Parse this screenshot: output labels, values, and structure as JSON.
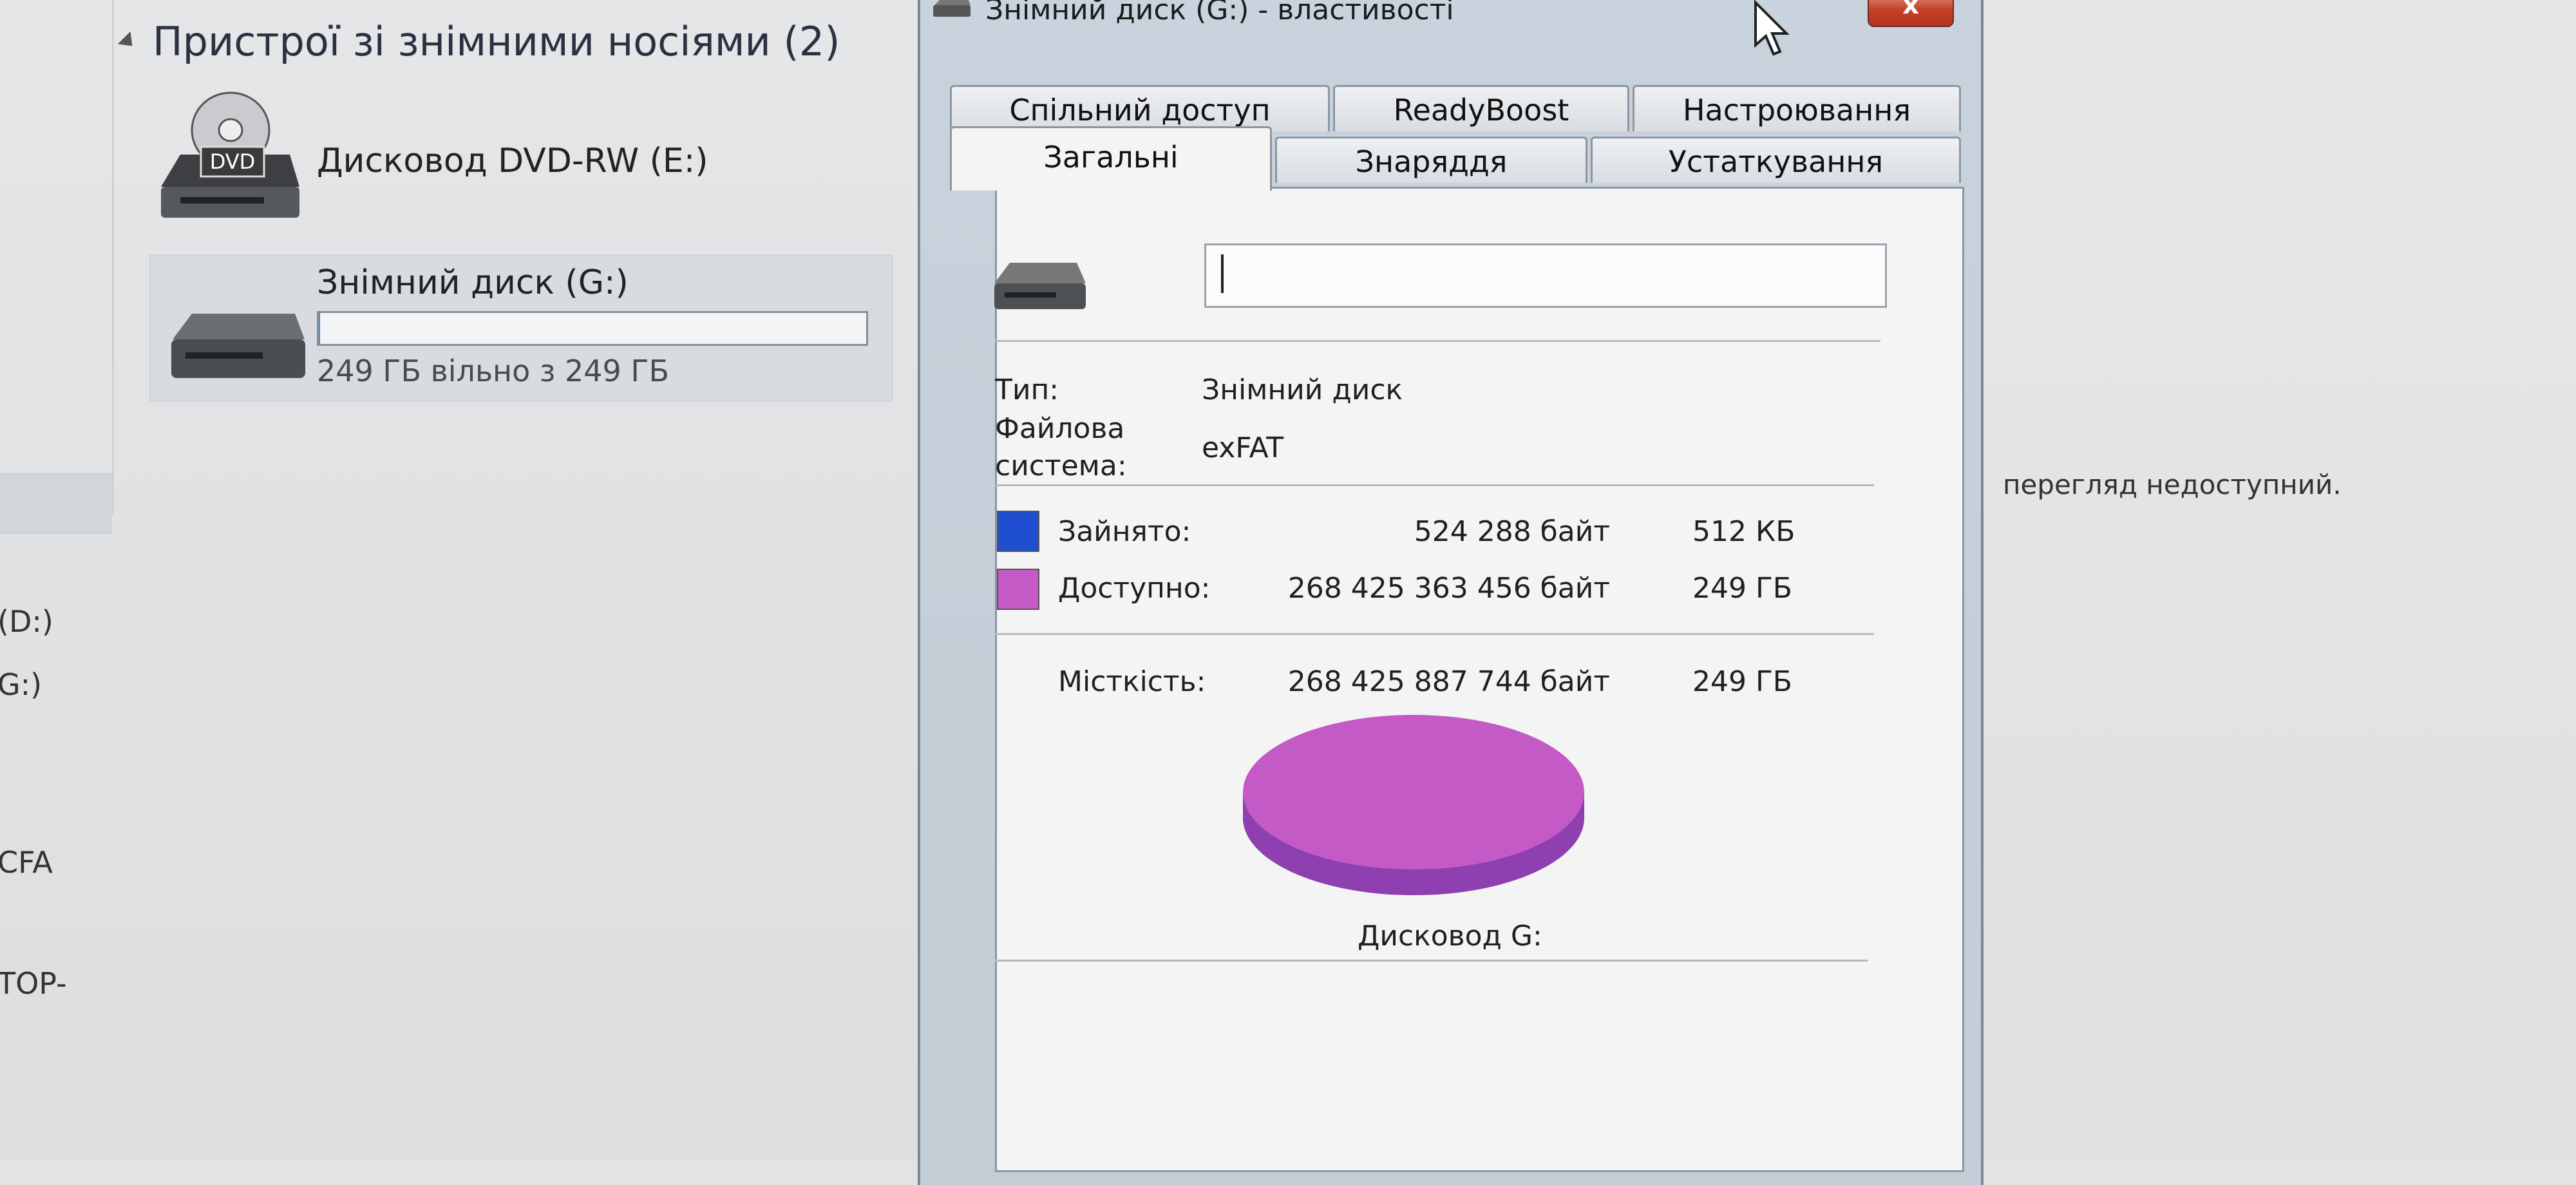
{
  "explorer": {
    "group_header": "Пристрої зі знімними носіями (2)",
    "devices": [
      {
        "name": "Дисковод DVD-RW (E:)",
        "icon": "dvd-drive-icon",
        "icon_label": "DVD"
      },
      {
        "name": "Знімний диск (G:)",
        "icon": "removable-drive-icon",
        "space_text": "249 ГБ вільно з 249 ГБ",
        "used_fraction": 0.002
      }
    ],
    "nav_fragments": [
      "(D:)",
      "G:)",
      "CFA",
      "TOP-"
    ],
    "preview_text": "перегляд недоступний."
  },
  "dialog": {
    "title": "Знімний диск (G:) - властивості",
    "close_label": "x",
    "tabs_row1": [
      "Спільний доступ",
      "ReadyBoost",
      "Настроювання"
    ],
    "tabs_row2": [
      "Загальні",
      "Знаряддя",
      "Устаткування"
    ],
    "active_tab": "Загальні",
    "name_value": "",
    "type_label": "Тип:",
    "type_value": "Знімний диск",
    "fs_label_line1": "Файлова",
    "fs_label_line2": "система:",
    "fs_value": "exFAT",
    "used": {
      "label": "Зайнято:",
      "bytes": "524 288 байт",
      "size": "512 КБ",
      "color": "#1f4fd0"
    },
    "free": {
      "label": "Доступно:",
      "bytes": "268 425 363 456 байт",
      "size": "249 ГБ",
      "color": "#c35ac6"
    },
    "capacity": {
      "label": "Місткість:",
      "bytes": "268 425 887 744 байт",
      "size": "249 ГБ"
    },
    "drive_label": "Дисковод G:"
  },
  "colors": {
    "pie_top": "#c35ac6",
    "pie_side": "#8e3fb0",
    "used_blue": "#1f4fd0"
  }
}
